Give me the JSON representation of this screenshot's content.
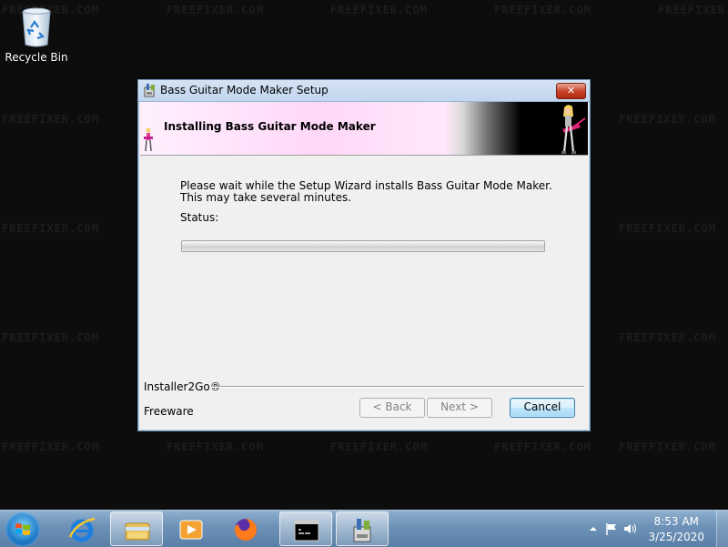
{
  "watermark": "FREEFIXER.COM",
  "desktop": {
    "recycle_bin_label": "Recycle Bin"
  },
  "window": {
    "title": "Bass Guitar Mode Maker Setup",
    "close_label": "✕",
    "banner_heading": "Installing Bass Guitar Mode Maker",
    "body_text": "Please wait while the Setup Wizard installs Bass Guitar Mode Maker.  This may take several minutes.",
    "status_label": "Status:",
    "progress_percent": 0,
    "brand_label": "Installer2Go®",
    "freeware_label": "Freeware",
    "back_label": "< Back",
    "next_label": "Next >",
    "cancel_label": "Cancel"
  },
  "taskbar": {
    "items": [
      "start-button",
      "internet-explorer",
      "file-explorer",
      "media-player",
      "firefox",
      "command-prompt",
      "setup-installer"
    ],
    "clock_time": "8:53 AM",
    "clock_date": "3/25/2020"
  },
  "colors": {
    "accent": "#3c7fb1",
    "close": "#c8452b",
    "taskbar": "#6f93b8"
  }
}
